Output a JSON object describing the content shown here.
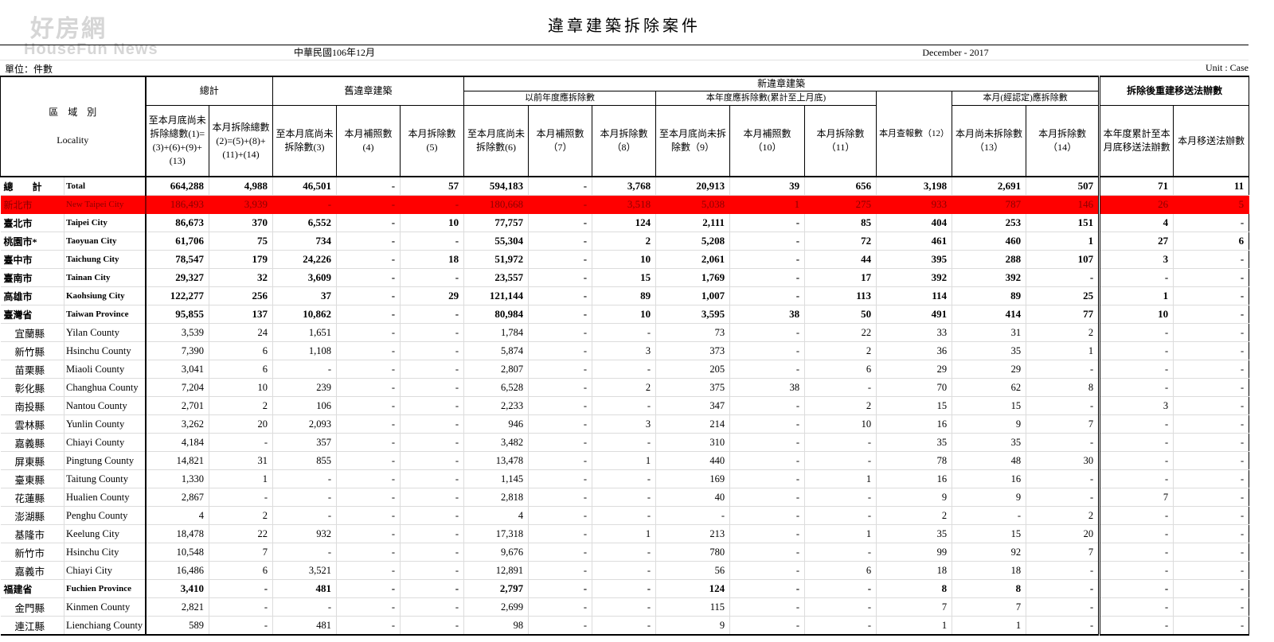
{
  "watermark": {
    "cn": "好房網",
    "en": "HouseFun News"
  },
  "title": "違章建築拆除案件",
  "period": {
    "cn": "中華民國106年12月",
    "en": "December   - 2017"
  },
  "unit": {
    "cn": "單位：件數",
    "en": "Unit : Case"
  },
  "headers": {
    "locality_cn": "區　域　別",
    "locality_en": "Locality",
    "groups": {
      "total": "總計",
      "old": "舊違章建築",
      "new": "新違章建築",
      "prior_year": "以前年度應拆除數",
      "this_year": "本年度應拆除數(累計至上月底)",
      "this_month_confirmed": "本月(經認定)應拆除數",
      "rebuild": "拆除後重建移送法辦數"
    },
    "columns": [
      "至本月底尚未拆除總數(1)=(3)+(6)+(9)+(13)",
      "本月拆除總數(2)=(5)+(8)+(11)+(14)",
      "至本月底尚未拆除數(3)",
      "本月補照數(4)",
      "本月拆除數(5)",
      "至本月底尚未拆除數(6)",
      "本月補照數（7）",
      "本月拆除數（8）",
      "至本月底尚未拆除數（9）",
      "本月補照數（10）",
      "本月拆除數（11）",
      "本月查報數（12）",
      "本月尚未拆除數（13）",
      "本月拆除數（14）",
      "本年度累計至本月底移送法辦數",
      "本月移送法辦數"
    ]
  },
  "rows": [
    {
      "cn": "總　　計",
      "en": "Total",
      "type": "bold",
      "values": [
        "664,288",
        "4,988",
        "46,501",
        "-",
        "57",
        "594,183",
        "-",
        "3,768",
        "20,913",
        "39",
        "656",
        "3,198",
        "2,691",
        "507",
        "71",
        "11"
      ]
    },
    {
      "cn": "新北市",
      "en": "New Taipei City",
      "type": "hl",
      "values": [
        "186,493",
        "3,939",
        "-",
        "-",
        "-",
        "180,668",
        "-",
        "3,518",
        "5,038",
        "1",
        "275",
        "933",
        "787",
        "146",
        "26",
        "5"
      ]
    },
    {
      "cn": "臺北市",
      "en": "Taipei City",
      "type": "bold",
      "values": [
        "86,673",
        "370",
        "6,552",
        "-",
        "10",
        "77,757",
        "-",
        "124",
        "2,111",
        "-",
        "85",
        "404",
        "253",
        "151",
        "4",
        "-"
      ]
    },
    {
      "cn": "桃園市*",
      "en": "Taoyuan City",
      "type": "bold",
      "values": [
        "61,706",
        "75",
        "734",
        "-",
        "-",
        "55,304",
        "-",
        "2",
        "5,208",
        "-",
        "72",
        "461",
        "460",
        "1",
        "27",
        "6"
      ]
    },
    {
      "cn": "臺中市",
      "en": "Taichung City",
      "type": "bold",
      "values": [
        "78,547",
        "179",
        "24,226",
        "-",
        "18",
        "51,972",
        "-",
        "10",
        "2,061",
        "-",
        "44",
        "395",
        "288",
        "107",
        "3",
        "-"
      ]
    },
    {
      "cn": "臺南市",
      "en": "Tainan City",
      "type": "bold",
      "values": [
        "29,327",
        "32",
        "3,609",
        "-",
        "-",
        "23,557",
        "-",
        "15",
        "1,769",
        "-",
        "17",
        "392",
        "392",
        "-",
        "-",
        "-"
      ]
    },
    {
      "cn": "高雄市",
      "en": "Kaohsiung City",
      "type": "bold",
      "values": [
        "122,277",
        "256",
        "37",
        "-",
        "29",
        "121,144",
        "-",
        "89",
        "1,007",
        "-",
        "113",
        "114",
        "89",
        "25",
        "1",
        "-"
      ]
    },
    {
      "cn": "臺灣省",
      "en": "Taiwan Province",
      "type": "bold",
      "values": [
        "95,855",
        "137",
        "10,862",
        "-",
        "-",
        "80,984",
        "-",
        "10",
        "3,595",
        "38",
        "50",
        "491",
        "414",
        "77",
        "10",
        "-"
      ]
    },
    {
      "cn": "宜蘭縣",
      "en": "Yilan County",
      "type": "sub",
      "values": [
        "3,539",
        "24",
        "1,651",
        "-",
        "-",
        "1,784",
        "-",
        "-",
        "73",
        "-",
        "22",
        "33",
        "31",
        "2",
        "-",
        "-"
      ]
    },
    {
      "cn": "新竹縣",
      "en": "Hsinchu County",
      "type": "sub",
      "values": [
        "7,390",
        "6",
        "1,108",
        "-",
        "-",
        "5,874",
        "-",
        "3",
        "373",
        "-",
        "2",
        "36",
        "35",
        "1",
        "-",
        "-"
      ]
    },
    {
      "cn": "苗栗縣",
      "en": "Miaoli County",
      "type": "sub",
      "values": [
        "3,041",
        "6",
        "-",
        "-",
        "-",
        "2,807",
        "-",
        "-",
        "205",
        "-",
        "6",
        "29",
        "29",
        "-",
        "-",
        "-"
      ]
    },
    {
      "cn": "彰化縣",
      "en": "Changhua County",
      "type": "sub",
      "values": [
        "7,204",
        "10",
        "239",
        "-",
        "-",
        "6,528",
        "-",
        "2",
        "375",
        "38",
        "-",
        "70",
        "62",
        "8",
        "-",
        "-"
      ]
    },
    {
      "cn": "南投縣",
      "en": "Nantou County",
      "type": "sub",
      "values": [
        "2,701",
        "2",
        "106",
        "-",
        "-",
        "2,233",
        "-",
        "-",
        "347",
        "-",
        "2",
        "15",
        "15",
        "-",
        "3",
        "-"
      ]
    },
    {
      "cn": "雲林縣",
      "en": "Yunlin County",
      "type": "sub",
      "values": [
        "3,262",
        "20",
        "2,093",
        "-",
        "-",
        "946",
        "-",
        "3",
        "214",
        "-",
        "10",
        "16",
        "9",
        "7",
        "-",
        "-"
      ]
    },
    {
      "cn": "嘉義縣",
      "en": "Chiayi County",
      "type": "sub",
      "values": [
        "4,184",
        "-",
        "357",
        "-",
        "-",
        "3,482",
        "-",
        "-",
        "310",
        "-",
        "-",
        "35",
        "35",
        "-",
        "-",
        "-"
      ]
    },
    {
      "cn": "屏東縣",
      "en": "Pingtung County",
      "type": "sub",
      "values": [
        "14,821",
        "31",
        "855",
        "-",
        "-",
        "13,478",
        "-",
        "1",
        "440",
        "-",
        "-",
        "78",
        "48",
        "30",
        "-",
        "-"
      ]
    },
    {
      "cn": "臺東縣",
      "en": "Taitung County",
      "type": "sub",
      "values": [
        "1,330",
        "1",
        "-",
        "-",
        "-",
        "1,145",
        "-",
        "-",
        "169",
        "-",
        "1",
        "16",
        "16",
        "-",
        "-",
        "-"
      ]
    },
    {
      "cn": "花蓮縣",
      "en": "Hualien County",
      "type": "sub",
      "values": [
        "2,867",
        "-",
        "-",
        "-",
        "-",
        "2,818",
        "-",
        "-",
        "40",
        "-",
        "-",
        "9",
        "9",
        "-",
        "7",
        "-"
      ]
    },
    {
      "cn": "澎湖縣",
      "en": "Penghu County",
      "type": "sub",
      "values": [
        "4",
        "2",
        "-",
        "-",
        "-",
        "4",
        "-",
        "-",
        "-",
        "-",
        "-",
        "2",
        "-",
        "2",
        "-",
        "-"
      ]
    },
    {
      "cn": "基隆市",
      "en": "Keelung City",
      "type": "sub",
      "values": [
        "18,478",
        "22",
        "932",
        "-",
        "-",
        "17,318",
        "-",
        "1",
        "213",
        "-",
        "1",
        "35",
        "15",
        "20",
        "-",
        "-"
      ]
    },
    {
      "cn": "新竹市",
      "en": "Hsinchu City",
      "type": "sub",
      "values": [
        "10,548",
        "7",
        "-",
        "-",
        "-",
        "9,676",
        "-",
        "-",
        "780",
        "-",
        "-",
        "99",
        "92",
        "7",
        "-",
        "-"
      ]
    },
    {
      "cn": "嘉義市",
      "en": "Chiayi City",
      "type": "sub",
      "values": [
        "16,486",
        "6",
        "3,521",
        "-",
        "-",
        "12,891",
        "-",
        "-",
        "56",
        "-",
        "6",
        "18",
        "18",
        "-",
        "-",
        "-"
      ]
    },
    {
      "cn": "福建省",
      "en": "Fuchien Province",
      "type": "bold",
      "values": [
        "3,410",
        "-",
        "481",
        "-",
        "-",
        "2,797",
        "-",
        "-",
        "124",
        "-",
        "-",
        "8",
        "8",
        "-",
        "-",
        "-"
      ]
    },
    {
      "cn": "金門縣",
      "en": "Kinmen County",
      "type": "sub",
      "values": [
        "2,821",
        "-",
        "-",
        "-",
        "-",
        "2,699",
        "-",
        "-",
        "115",
        "-",
        "-",
        "7",
        "7",
        "-",
        "-",
        "-"
      ]
    },
    {
      "cn": "連江縣",
      "en": "Lienchiang County",
      "type": "sub",
      "values": [
        "589",
        "-",
        "481",
        "-",
        "-",
        "98",
        "-",
        "-",
        "9",
        "-",
        "-",
        "1",
        "1",
        "-",
        "-",
        "-"
      ]
    }
  ],
  "colors": {
    "highlight_row": "#ff0000",
    "highlight_text": "#8a0000"
  }
}
